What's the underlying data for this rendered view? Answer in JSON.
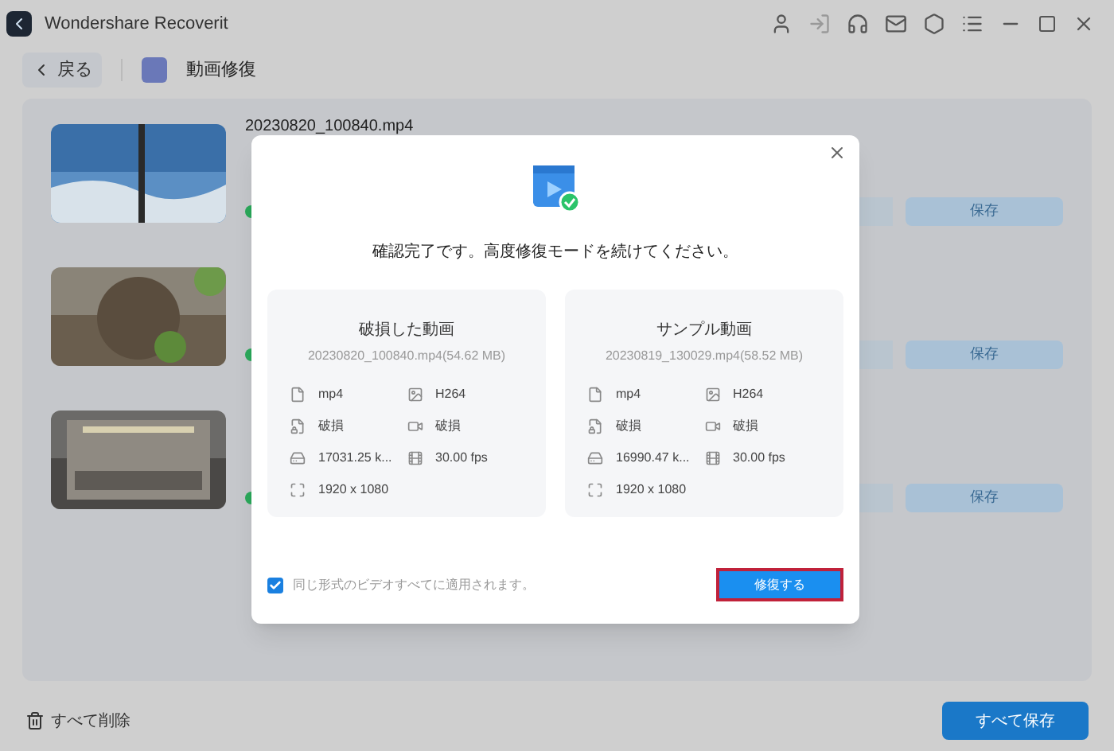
{
  "window": {
    "title": "Wondershare Recoverit"
  },
  "nav": {
    "back": "戻る",
    "section": "動画修復"
  },
  "files": [
    {
      "name": "20230820_100840.mp4",
      "save": "保存"
    },
    {
      "save": "保存"
    },
    {
      "save": "保存"
    }
  ],
  "dialog": {
    "message": "確認完了です。高度修復モードを続けてください。",
    "cards": [
      {
        "title": "破損した動画",
        "file": "20230820_100840.mp4(54.62  MB)",
        "details": [
          "mp4",
          "H264",
          "破損",
          "破損",
          "17031.25 k...",
          "30.00 fps",
          "1920 x 1080"
        ]
      },
      {
        "title": "サンプル動画",
        "file": "20230819_130029.mp4(58.52  MB)",
        "details": [
          "mp4",
          "H264",
          "破損",
          "破損",
          "16990.47 k...",
          "30.00 fps",
          "1920 x 1080"
        ]
      }
    ],
    "apply_all": {
      "label": "同じ形式のビデオすべてに適用されます。",
      "checked": true
    },
    "repair": "修復する"
  },
  "footer": {
    "delete_all": "すべて削除",
    "save_all": "すべて保存"
  }
}
